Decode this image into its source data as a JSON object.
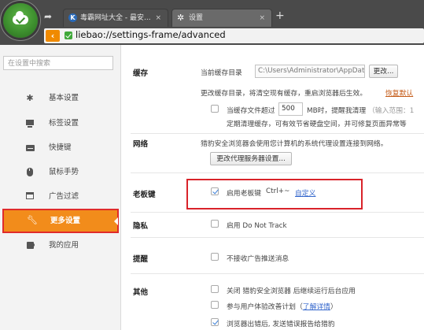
{
  "browser": {
    "tabs": [
      {
        "icon": "K",
        "label": "毒霸网址大全 - 最安...",
        "close": "×"
      },
      {
        "icon": "gear-icon",
        "label": "设置",
        "close": "×"
      }
    ],
    "new_tab": "+",
    "back": "‹",
    "url": "liebao://settings-frame/advanced"
  },
  "sidebar": {
    "search_placeholder": "在设置中搜索",
    "items": [
      {
        "label": "基本设置",
        "icon": "gear-icon"
      },
      {
        "label": "标签设置",
        "icon": "monitor-icon"
      },
      {
        "label": "快捷键",
        "icon": "keyboard-icon"
      },
      {
        "label": "鼠标手势",
        "icon": "mouse-icon"
      },
      {
        "label": "广告过滤",
        "icon": "window-icon"
      },
      {
        "label": "更多设置",
        "icon": "wrench-icon",
        "active": true
      },
      {
        "label": "我的应用",
        "icon": "puzzle-icon"
      }
    ]
  },
  "main": {
    "cache": {
      "title": "缓存",
      "dir_label": "当前缓存目录",
      "dir_value": "C:\\Users\\Administrator\\AppData",
      "change_button": "更改...",
      "note": "更改缓存目录，将清空现有缓存，重启浏览器后生效。",
      "restore_link": "恢复默认",
      "limit_prefix": "当缓存文件超过",
      "limit_value": "500",
      "limit_suffix": "MB时，提醒我清理",
      "limit_range": "（输入范围：1",
      "limit_desc": "定期清理缓存，可有效节省硬盘空间，并可修复页面异常等"
    },
    "network": {
      "title": "网络",
      "desc": "猎豹安全浏览器会使用您计算机的系统代理设置连接到网络。",
      "button": "更改代理服务器设置..."
    },
    "boss_key": {
      "title": "老板键",
      "checkbox_label": "启用老板键",
      "shortcut": "Ctrl+~",
      "customize_link": "自定义"
    },
    "privacy": {
      "title": "隐私",
      "checkbox_label": "启用 Do Not Track"
    },
    "notify": {
      "title": "提醒",
      "checkbox_label": "不接收广告推送消息"
    },
    "other": {
      "title": "其他",
      "opt1": "关闭 猎豹安全浏览器 后继续运行后台应用",
      "opt2_prefix": "参与用户体验改善计划（",
      "opt2_link": "了解详情",
      "opt2_suffix": "）",
      "opt3": "浏览器出错后, 发送错误报告给猎豹"
    }
  },
  "colors": {
    "accent": "#f28c1b",
    "highlight": "#d9232a",
    "chrome": "#4a4a4a"
  }
}
